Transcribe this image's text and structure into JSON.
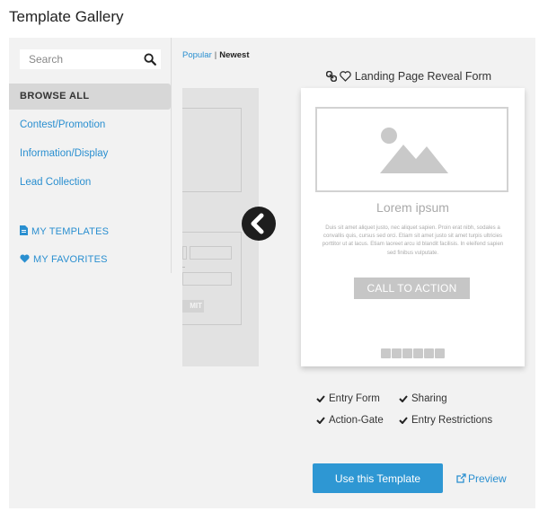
{
  "page": {
    "title": "Template Gallery"
  },
  "search": {
    "placeholder": "Search"
  },
  "sidebar": {
    "browse_all": "BROWSE ALL",
    "categories": [
      "Contest/Promotion",
      "Information/Display",
      "Lead Collection"
    ],
    "my_templates": "MY TEMPLATES",
    "my_favorites": "MY FAVORITES"
  },
  "sort": {
    "popular": "Popular",
    "newest": "Newest"
  },
  "ghost": {
    "submit_fragment": "MIT",
    "paren": ")"
  },
  "template": {
    "name": "Landing Page Reveal Form",
    "lorem_title": "Lorem ipsum",
    "lorem_body": "Duis sit amet aliquet justo, nec aliquet sapien. Proin erat nibh, sodales a convallis quis, cursus sed orci. Etiam sit amet justo sit amet turpis ultricies porttitor ut at lacus. Etiam laoreet arcu id blandit facilisis. In eleifend sapien sed finibus vulputate.",
    "cta": "CALL TO ACTION",
    "features": [
      "Entry Form",
      "Sharing",
      "Action-Gate",
      "Entry Restrictions"
    ]
  },
  "actions": {
    "use_template": "Use this Template",
    "preview": "Preview"
  },
  "colors": {
    "accent": "#2e97d3",
    "link": "#2a8fd0",
    "panel": "#f2f2f2"
  }
}
